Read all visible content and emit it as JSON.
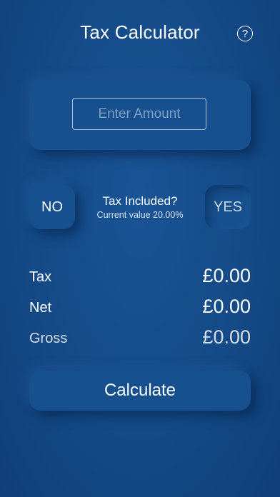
{
  "header": {
    "title": "Tax Calculator",
    "help_symbol": "?"
  },
  "amount": {
    "placeholder": "Enter Amount",
    "value": ""
  },
  "tax_toggle": {
    "no_label": "NO",
    "yes_label": "YES",
    "question": "Tax Included?",
    "current_value_text": "Current value 20.00%"
  },
  "results": {
    "tax_label": "Tax",
    "tax_value": "£0.00",
    "net_label": "Net",
    "net_value": "£0.00",
    "gross_label": "Gross",
    "gross_value": "£0.00"
  },
  "actions": {
    "calculate_label": "Calculate"
  },
  "colors": {
    "background": "#144a87",
    "text": "#ffffff"
  },
  "icons": {
    "help": "question-circle-icon"
  }
}
